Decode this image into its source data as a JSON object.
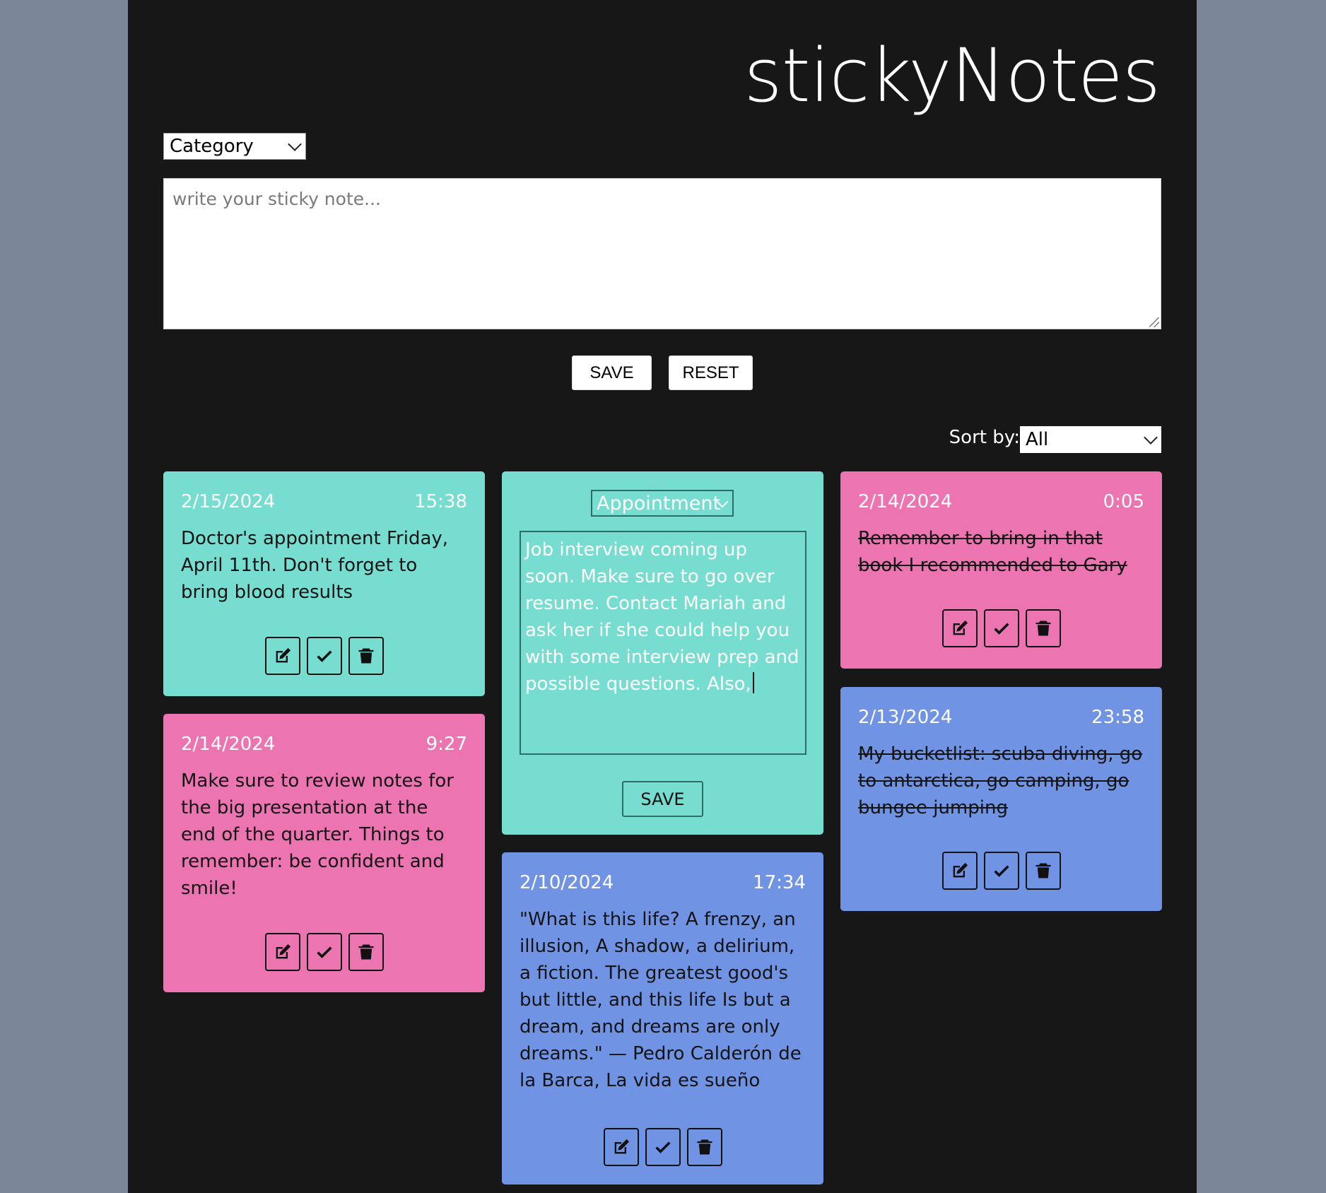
{
  "app": {
    "title": "stickyNotes"
  },
  "composer": {
    "category_select": "Category",
    "placeholder": "write your sticky note...",
    "save_label": "SAVE",
    "reset_label": "RESET"
  },
  "sort": {
    "label": "Sort by:",
    "value": "All"
  },
  "notes": [
    {
      "date": "2/15/2024",
      "time": "15:38",
      "text": "Doctor's appointment Friday, April 11th. Don't forget to bring blood results",
      "color": "#76ddd0",
      "completed": false
    },
    {
      "date": "2/14/2024",
      "time": "9:27",
      "text": "Make sure to review notes for the big presentation at the end of the quarter. Things to remember: be confident and smile!",
      "color": "#ec74b1",
      "completed": false
    },
    {
      "date": "2/10/2024",
      "time": "17:34",
      "text": "\"What is this life? A frenzy, an illusion, A shadow, a delirium, a fiction. The greatest good's but little, and this life Is but a dream, and dreams are only dreams.\" — Pedro Calderón de la Barca, La vida es sueño",
      "color": "#7193e4",
      "completed": false
    },
    {
      "date": "2/14/2024",
      "time": "0:05",
      "text": "Remember to bring in that book I recommended to Gary",
      "color": "#ec74b1",
      "completed": true
    },
    {
      "date": "2/13/2024",
      "time": "23:58",
      "text": "My bucketlist: scuba diving, go to antarctica, go camping, go bungee jumping",
      "color": "#7193e4",
      "completed": true
    }
  ],
  "editing_note": {
    "category": "Appointment",
    "text": "Job interview coming up soon. Make sure to go over resume. Contact Mariah and ask her if she could help you with some interview prep and possible questions.  Also,",
    "save_label": "SAVE",
    "color": "#76ddd0"
  },
  "icons": [
    "edit-icon",
    "check-icon",
    "trash-icon"
  ]
}
